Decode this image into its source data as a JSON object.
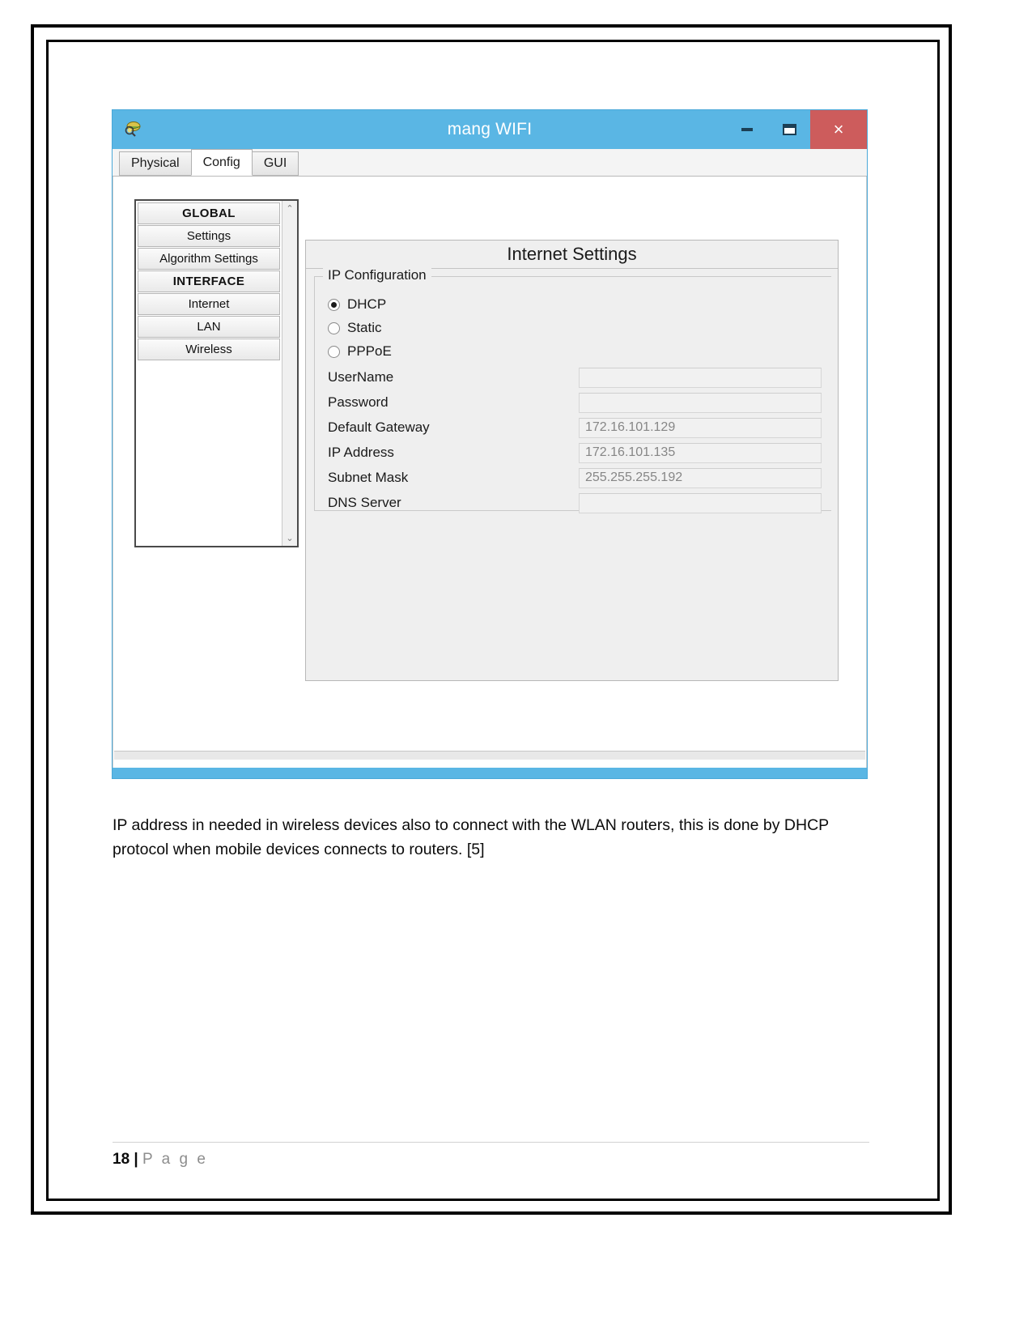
{
  "figure": {
    "window": {
      "title": "mang WIFI",
      "app_icon": "device-icon",
      "controls": {
        "minimize_label": "–",
        "maximize_label": "❐",
        "close_label": "×"
      },
      "titlebar_color": "#5ab6e4",
      "close_color": "#cd5c5c"
    },
    "tabs": [
      {
        "label": "Physical",
        "active": false
      },
      {
        "label": "Config",
        "active": true
      },
      {
        "label": "GUI",
        "active": false
      }
    ],
    "sidebar": {
      "items": [
        {
          "label": "GLOBAL",
          "type": "header"
        },
        {
          "label": "Settings",
          "type": "item"
        },
        {
          "label": "Algorithm Settings",
          "type": "item"
        },
        {
          "label": "INTERFACE",
          "type": "header"
        },
        {
          "label": "Internet",
          "type": "item"
        },
        {
          "label": "LAN",
          "type": "item"
        },
        {
          "label": "Wireless",
          "type": "item"
        }
      ],
      "scroll_up": "⌃",
      "scroll_down": "⌄"
    },
    "panel": {
      "title": "Internet Settings",
      "fieldset_legend": "IP Configuration",
      "radios": [
        {
          "label": "DHCP",
          "selected": true
        },
        {
          "label": "Static",
          "selected": false
        },
        {
          "label": "PPPoE",
          "selected": false
        }
      ],
      "fields": [
        {
          "label": "UserName",
          "value": ""
        },
        {
          "label": "Password",
          "value": ""
        },
        {
          "label": "Default Gateway",
          "value": "172.16.101.129"
        },
        {
          "label": "IP Address",
          "value": "172.16.101.135"
        },
        {
          "label": "Subnet Mask",
          "value": "255.255.255.192"
        },
        {
          "label": "DNS Server",
          "value": ""
        }
      ]
    }
  },
  "body": {
    "paragraph": "IP address in needed in wireless devices also to connect with the WLAN routers, this is done by DHCP protocol when mobile devices connects to routers.  [5]"
  },
  "footer": {
    "page_number": "18",
    "separator": "|",
    "word": "P a g e"
  }
}
